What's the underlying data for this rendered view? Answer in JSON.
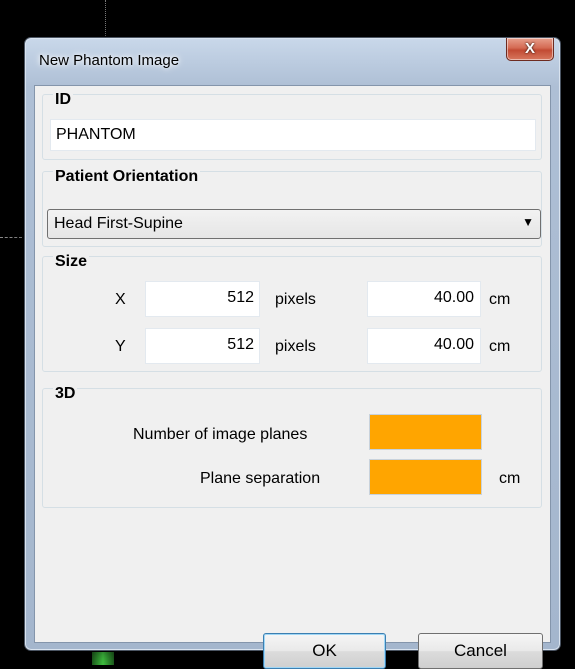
{
  "window": {
    "title": "New Phantom Image",
    "close_glyph": "X"
  },
  "id_group": {
    "label": "ID",
    "value": "PHANTOM"
  },
  "orientation_group": {
    "label": "Patient Orientation",
    "selected": "Head First-Supine"
  },
  "size_group": {
    "label": "Size",
    "rows": [
      {
        "axis": "X",
        "pixels": "512",
        "pixel_unit": "pixels",
        "length": "40.00",
        "length_unit": "cm"
      },
      {
        "axis": "Y",
        "pixels": "512",
        "pixel_unit": "pixels",
        "length": "40.00",
        "length_unit": "cm"
      }
    ]
  },
  "three_d_group": {
    "label": "3D",
    "planes_label": "Number of image planes",
    "separation_label": "Plane separation",
    "separation_unit": "cm",
    "field_color": "#ffa500"
  },
  "buttons": {
    "ok": "OK",
    "cancel": "Cancel"
  },
  "icons": {
    "close": "close-icon",
    "dropdown": "chevron-down-icon"
  }
}
